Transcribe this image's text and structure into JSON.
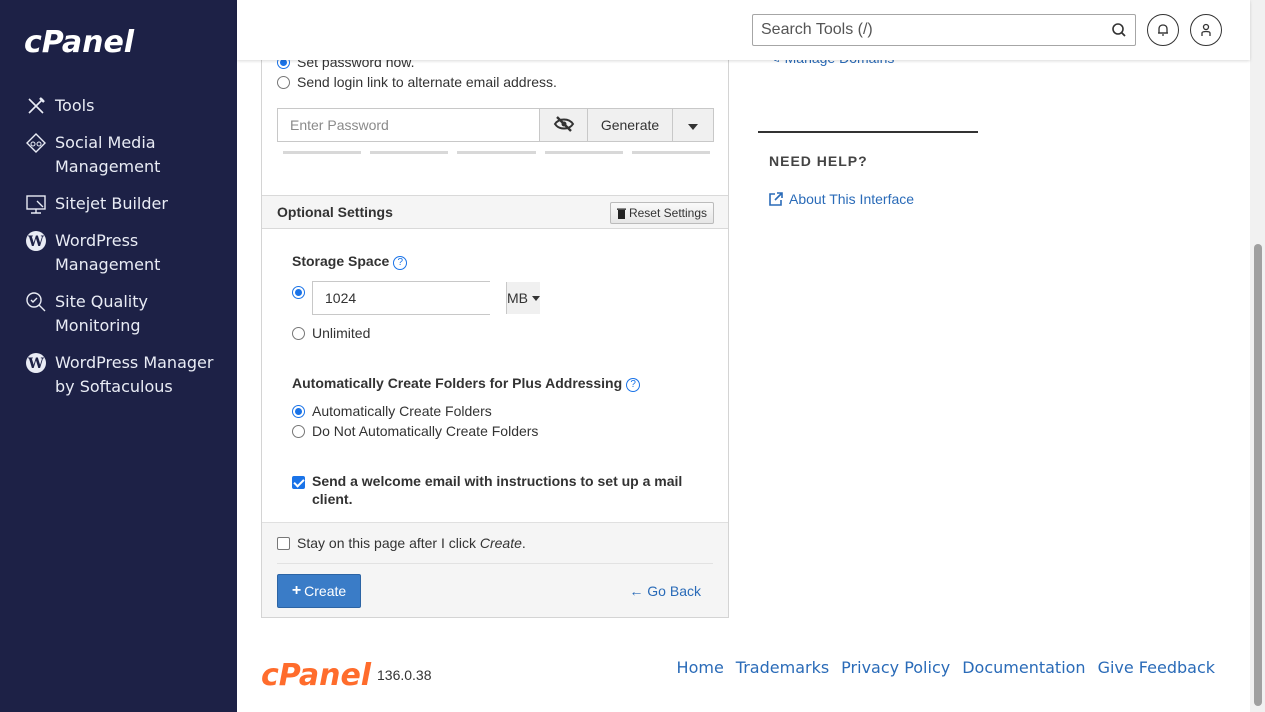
{
  "sidebar": {
    "logo_text": "cPanel",
    "items": [
      {
        "label": "Tools",
        "icon": "tools-icon"
      },
      {
        "label": "Social Media Management",
        "icon": "social-media-icon"
      },
      {
        "label": "Sitejet Builder",
        "icon": "sitejet-icon"
      },
      {
        "label": "WordPress Management",
        "icon": "wordpress-icon"
      },
      {
        "label": "Site Quality Monitoring",
        "icon": "site-quality-icon"
      },
      {
        "label": "WordPress Manager by Softaculous",
        "icon": "wordpress-icon"
      }
    ]
  },
  "header": {
    "search_placeholder": "Search Tools (/)"
  },
  "password": {
    "option_set_now": "Set password now.",
    "option_send_link": "Send login link to alternate email address.",
    "placeholder": "Enter Password",
    "generate_label": "Generate"
  },
  "optional": {
    "title": "Optional Settings",
    "reset_label": "Reset Settings",
    "storage_label": "Storage Space",
    "storage_value": "1024",
    "storage_unit": "MB",
    "unlimited_label": "Unlimited",
    "plus_addressing_label": "Automatically Create Folders for Plus Addressing",
    "auto_create_label": "Automatically Create Folders",
    "no_auto_create_label": "Do Not Automatically Create Folders",
    "welcome_email_label": "Send a welcome email with instructions to set up a mail client."
  },
  "actions": {
    "stay_label_prefix": "Stay on this page after I click ",
    "stay_label_em": "Create",
    "stay_label_suffix": ".",
    "create_label": "Create",
    "go_back_label": "Go Back"
  },
  "right": {
    "manage_domains": "Manage Domains",
    "need_help": "NEED HELP?",
    "about_interface": "About This Interface"
  },
  "footer": {
    "version": "136.0.38",
    "links": [
      "Home",
      "Trademarks",
      "Privacy Policy",
      "Documentation",
      "Give Feedback"
    ]
  },
  "colors": {
    "sidebar_bg": "#1d2146",
    "brand_orange": "#ff6c2c",
    "link_blue": "#2a6bb8",
    "primary_button": "#3a7cc7"
  }
}
